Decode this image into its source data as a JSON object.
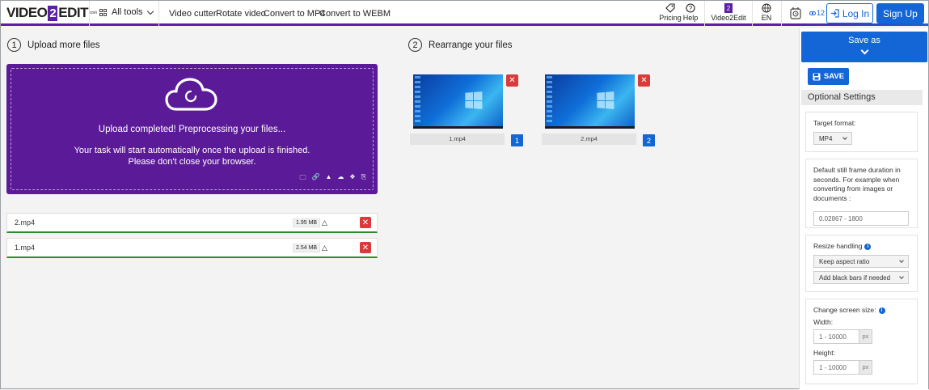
{
  "header": {
    "logo_a": "VIDEO",
    "logo_b": "2",
    "logo_c": "EDIT",
    "all_tools": "All tools",
    "nav": [
      "Video cutter",
      "Rotate video",
      "Convert to MP4",
      "Convert to WEBM"
    ],
    "pricing": "Pricing",
    "help": "Help",
    "video2edit": "Video2Edit",
    "language": "EN",
    "badge_count": "12",
    "login": "Log In",
    "signup": "Sign Up"
  },
  "upload": {
    "step_num": "1",
    "step_label": "Upload more files",
    "status": "Upload completed! Preprocessing your files...",
    "line1": "Your task will start automatically once the upload is finished.",
    "line2": "Please don't close your browser."
  },
  "files": [
    {
      "name": "2.mp4",
      "size": "1.95 MB"
    },
    {
      "name": "1.mp4",
      "size": "2.54 MB"
    }
  ],
  "rearrange": {
    "step_num": "2",
    "step_label": "Rearrange your files",
    "items": [
      {
        "name": "1.mp4",
        "order": "1"
      },
      {
        "name": "2.mp4",
        "order": "2"
      }
    ]
  },
  "sidebar": {
    "save_as": "Save as",
    "save": "SAVE",
    "optional_settings": "Optional Settings",
    "target_format_label": "Target format:",
    "target_format_value": "MP4",
    "frame_duration_label": "Default still frame duration in seconds. For example when converting from images or documents :",
    "frame_duration_placeholder": "0.02867 - 1800",
    "resize_label": "Resize handling",
    "resize_option1": "Keep aspect ratio",
    "resize_option2": "Add black bars if needed",
    "screen_size_label": "Change screen size:",
    "width_label": "Width:",
    "width_placeholder": "1 - 10000",
    "height_label": "Height:",
    "height_placeholder": "1 - 10000",
    "px_unit": "px"
  },
  "colors": {
    "brand_purple": "#5b1a98",
    "brand_blue": "#1466d6",
    "delete_red": "#d93a3a",
    "success_green": "#2e8b2e"
  }
}
